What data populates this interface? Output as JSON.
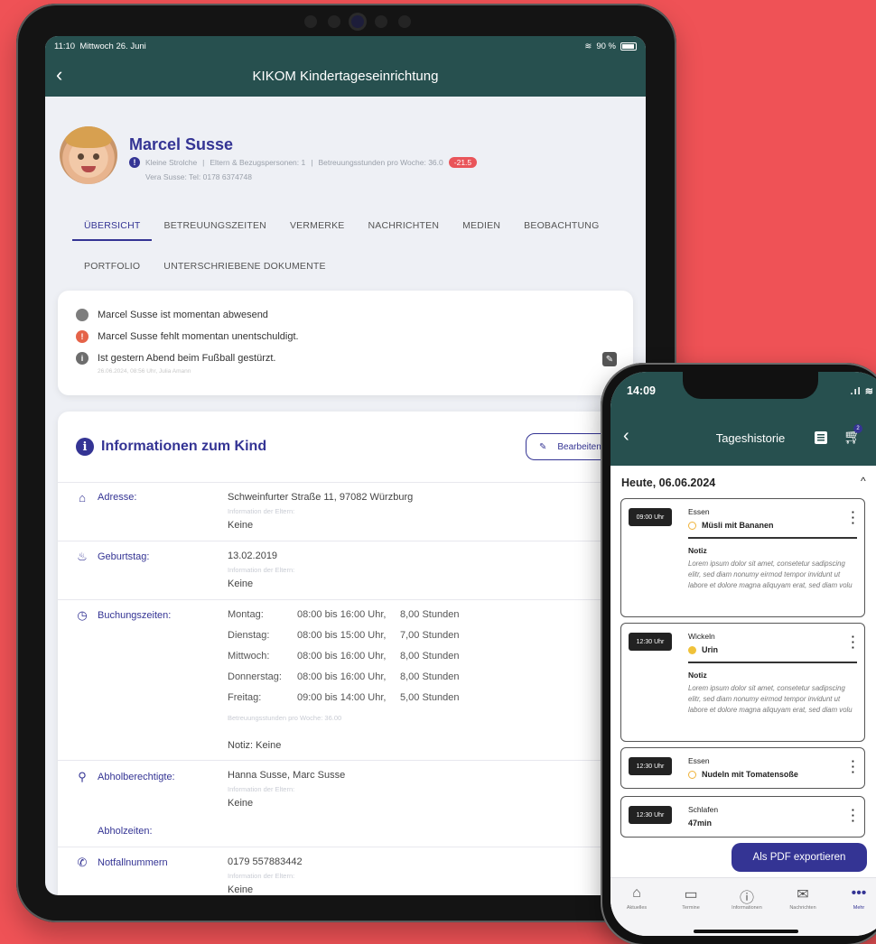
{
  "tablet": {
    "status": {
      "time": "11:10",
      "date": "Mittwoch 26. Juni",
      "battery": "90 %"
    },
    "nav": {
      "title": "KIKOM Kindertageseinrichtung",
      "back": "‹"
    },
    "profile": {
      "name": "Marcel Susse",
      "group": "Kleine Strolche",
      "separator": "|",
      "parents": "Eltern & Bezugspersonen: 1",
      "hours": "Betreuungsstunden pro Woche: 36.0",
      "badge": "-21.5",
      "contact": "Vera Susse: Tel: 0178 6374748"
    },
    "tabs_row1": [
      "ÜBERSICHT",
      "BETREUUNGSZEITEN",
      "VERMERKE",
      "NACHRICHTEN",
      "MEDIEN",
      "BEOBACHTUNG"
    ],
    "tabs_row2": [
      "PORTFOLIO",
      "UNTERSCHRIEBENE DOKUMENTE"
    ],
    "alerts": {
      "absent": "Marcel Susse ist momentan abwesend",
      "unexcused": "Marcel Susse fehlt momentan unentschuldigt.",
      "note": "Ist gestern Abend beim Fußball gestürzt.",
      "note_meta": "26.06.2024, 08:56 Uhr, Julia Amann"
    },
    "info": {
      "title": "Informationen zum Kind",
      "edit_label": "Bearbeiten",
      "address_label": "Adresse:",
      "address_value": "Schweinfurter Straße 11, 97082 Würzburg",
      "parent_info_label": "Information der Eltern:",
      "none": "Keine",
      "birthday_label": "Geburtstag:",
      "birthday_value": "13.02.2019",
      "booking_label": "Buchungszeiten:",
      "booking": [
        {
          "day": "Montag:",
          "time": "08:00 bis 16:00 Uhr,",
          "hours": "8,00 Stunden"
        },
        {
          "day": "Dienstag:",
          "time": "08:00 bis 15:00 Uhr,",
          "hours": "7,00 Stunden"
        },
        {
          "day": "Mittwoch:",
          "time": "08:00 bis 16:00 Uhr,",
          "hours": "8,00 Stunden"
        },
        {
          "day": "Donnerstag:",
          "time": "08:00 bis 16:00 Uhr,",
          "hours": "8,00 Stunden"
        },
        {
          "day": "Freitag:",
          "time": "09:00 bis 14:00 Uhr,",
          "hours": "5,00 Stunden"
        }
      ],
      "booking_total": "Betreuungsstunden pro Woche: 36.00",
      "booking_note": "Notiz: Keine",
      "pickup_label": "Abholberechtigte:",
      "pickup_value": "Hanna Susse, Marc Susse",
      "pickup_times_label": "Abholzeiten:",
      "emergency_label": "Notfallnummern",
      "emergency_value": "0179 557883442"
    }
  },
  "phone": {
    "status": {
      "time": "14:09",
      "signal": ".ıl ≋"
    },
    "nav": {
      "title": "Tageshistorie",
      "back": "‹",
      "cart_count": "2"
    },
    "date_heading": "Heute, 06.06.2024",
    "chevron": "^",
    "entries": [
      {
        "time": "09:00 Uhr",
        "type": "Essen",
        "value": "Müsli mit Bananen",
        "note_label": "Notiz",
        "note": "Lorem ipsum dolor sit amet, consetetur sadipscing elitr, sed diam nonumy eirmod tempor invidunt ut labore et dolore magna aliquyam erat, sed diam volu"
      },
      {
        "time": "12:30 Uhr",
        "type": "Wickeln",
        "value": "Urin",
        "note_label": "Notiz",
        "note": "Lorem ipsum dolor sit amet, consetetur sadipscing elitr, sed diam nonumy eirmod tempor invidunt ut labore et dolore magna aliquyam erat, sed diam volu"
      },
      {
        "time": "12:30 Uhr",
        "type": "Essen",
        "value": "Nudeln mit Tomatensoße"
      },
      {
        "time": "12:30 Uhr",
        "type": "Schlafen",
        "value": "47min"
      }
    ],
    "pdf_button": "Als PDF exportieren",
    "bottom_nav": [
      {
        "label": "Aktuelles",
        "icon": "home-icon"
      },
      {
        "label": "Termine",
        "icon": "calendar-icon"
      },
      {
        "label": "Informationen",
        "icon": "info-icon"
      },
      {
        "label": "Nachrichten",
        "icon": "mail-icon"
      },
      {
        "label": "Mehr",
        "icon": "more-icon"
      }
    ]
  },
  "colors": {
    "background": "#ef5256",
    "primary": "#343494",
    "header": "#27504f",
    "danger": "#e9555a"
  }
}
